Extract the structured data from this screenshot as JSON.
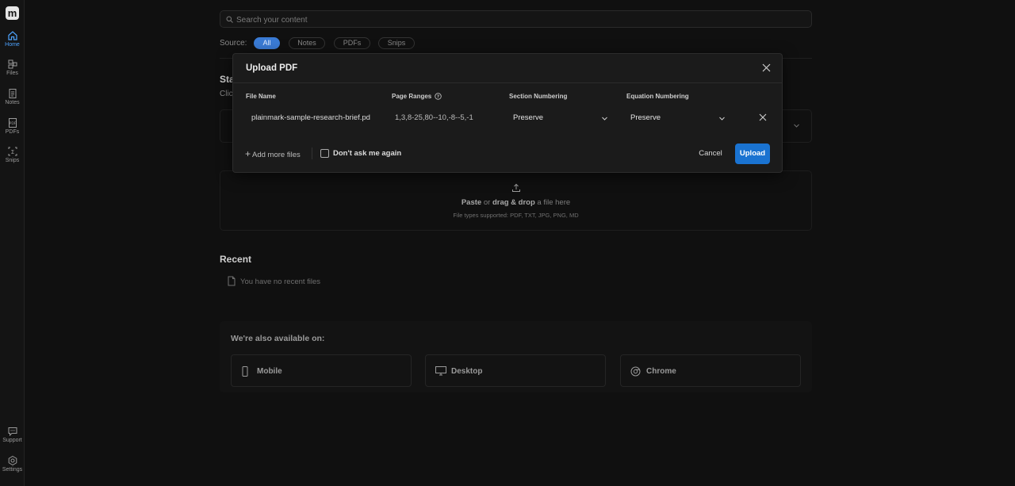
{
  "sidebar": {
    "logo": "m",
    "items": [
      {
        "label": "Home",
        "icon": "home-icon",
        "active": true
      },
      {
        "label": "Files",
        "icon": "files-icon"
      },
      {
        "label": "Notes",
        "icon": "notes-icon"
      },
      {
        "label": "PDFs",
        "icon": "pdf-icon"
      },
      {
        "label": "Snips",
        "icon": "snips-icon"
      }
    ],
    "bottom": [
      {
        "label": "Support",
        "icon": "support-icon"
      },
      {
        "label": "Settings",
        "icon": "settings-icon"
      }
    ]
  },
  "search": {
    "placeholder": "Search your content"
  },
  "source": {
    "label": "Source:",
    "chips": [
      "All",
      "Notes",
      "PDFs",
      "Snips"
    ],
    "selected": "All"
  },
  "start": {
    "heading": "Sta",
    "sub": "Click"
  },
  "dropzone": {
    "paste": "Paste",
    "or": " or ",
    "drag": "drag & drop",
    "rest": " a file here",
    "types": "File types supported: PDF, TXT, JPG, PNG, MD"
  },
  "recent": {
    "title": "Recent",
    "empty": "You have no recent files"
  },
  "available": {
    "title": "We're also available on:",
    "platforms": [
      "Mobile",
      "Desktop",
      "Chrome"
    ]
  },
  "modal": {
    "title": "Upload PDF",
    "columns": {
      "file_name": "File Name",
      "page_ranges": "Page Ranges",
      "section_numbering": "Section Numbering",
      "equation_numbering": "Equation Numbering"
    },
    "row": {
      "file_name": "plainmark-sample-research-brief.pdf",
      "page_ranges": "1,3,8-25,80--10,-8--5,-1",
      "section_numbering": "Preserve",
      "equation_numbering": "Preserve"
    },
    "add_more": "Add more files",
    "dont_ask": "Don't ask me again",
    "cancel": "Cancel",
    "upload": "Upload"
  },
  "colors": {
    "accent": "#1a73d1",
    "chip_active": "#3a7bd5",
    "background": "#0f0f0f",
    "modal": "#1b1b1b"
  }
}
